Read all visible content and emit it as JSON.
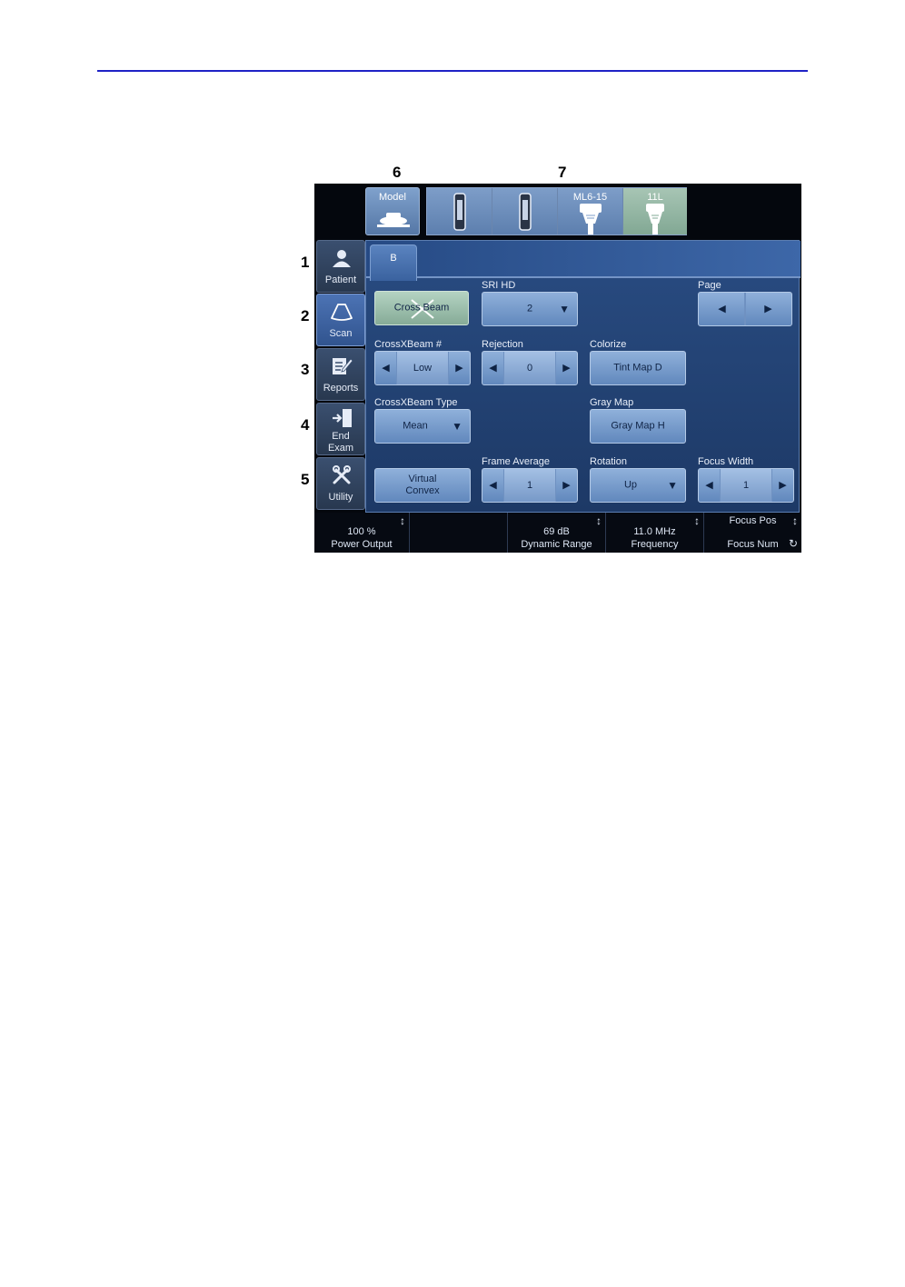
{
  "callouts": [
    "6",
    "7",
    "1",
    "2",
    "3",
    "4",
    "5"
  ],
  "probe_bar": {
    "model_label": "Model",
    "probes": [
      {
        "label": "",
        "state": "normal"
      },
      {
        "label": "",
        "state": "normal"
      },
      {
        "label": "ML6-15",
        "state": "normal"
      },
      {
        "label": "11L",
        "state": "active"
      }
    ]
  },
  "sidebar": {
    "tabs": [
      {
        "label": "Patient",
        "icon": "person-icon"
      },
      {
        "label": "Scan",
        "icon": "scan-probe-icon",
        "active": true
      },
      {
        "label": "Reports",
        "icon": "report-pencil-icon"
      },
      {
        "label_line1": "End",
        "label_line2": "Exam",
        "icon": "exit-door-icon"
      },
      {
        "label": "Utility",
        "icon": "tools-icon"
      }
    ]
  },
  "panel": {
    "tab_label": "B",
    "cross_beam_label": "Cross Beam",
    "sri_hd": {
      "label": "SRI HD",
      "value": "2"
    },
    "page": {
      "label": "Page"
    },
    "crossxbeam_num": {
      "label": "CrossXBeam #",
      "value": "Low"
    },
    "rejection": {
      "label": "Rejection",
      "value": "0"
    },
    "colorize": {
      "label": "Colorize",
      "value": "Tint Map D"
    },
    "crossxbeam_type": {
      "label": "CrossXBeam Type",
      "value": "Mean"
    },
    "gray_map": {
      "label": "Gray Map",
      "value": "Gray Map H"
    },
    "virtual_convex": {
      "line1": "Virtual",
      "line2": "Convex"
    },
    "frame_average": {
      "label": "Frame Average",
      "value": "1"
    },
    "rotation": {
      "label": "Rotation",
      "value": "Up"
    },
    "focus_width": {
      "label": "Focus Width",
      "value": "1"
    }
  },
  "status_bar": {
    "power_output": {
      "value": "100 %",
      "label": "Power Output"
    },
    "dynamic_range": {
      "value": "69 dB",
      "label": "Dynamic Range"
    },
    "frequency": {
      "value": "11.0 MHz",
      "label": "Frequency"
    },
    "focus": {
      "top": "Focus Pos",
      "bottom": "Focus Num"
    }
  },
  "glyphs": {
    "left": "◀",
    "right": "▶",
    "down": "▼",
    "updown": "↕",
    "rotate": "↻"
  },
  "colors": {
    "panel": "#294c82",
    "button": "#8fb0da",
    "active_green": "#b4d3c2",
    "top_rule": "#1e22c6"
  }
}
